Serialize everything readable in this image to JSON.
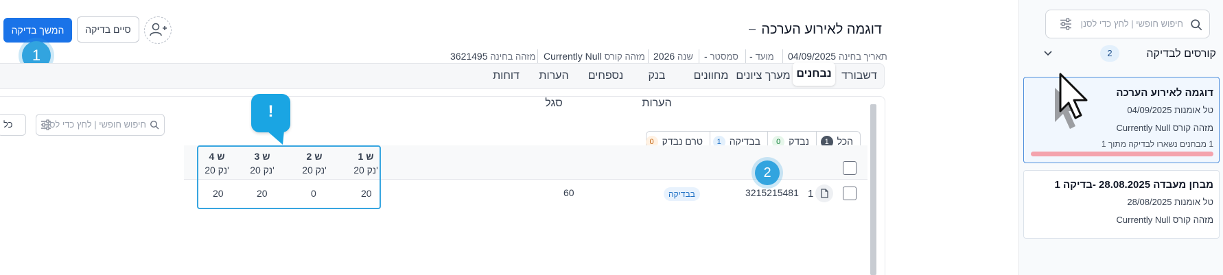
{
  "header": {
    "title": "דוגמה לאירוע הערכה",
    "collapse_symbol": "–",
    "continue_button": "המשך בדיקה",
    "finish_button": "סיים בדיקה",
    "meta": [
      {
        "label": "תאריך בחינה",
        "value": "04/09/2025"
      },
      {
        "label": "מועד",
        "value": "-"
      },
      {
        "label": "סמסטר",
        "value": "-"
      },
      {
        "label": "שנה",
        "value": "2026"
      },
      {
        "label": "מזהה קורס",
        "value": "Currently Null"
      },
      {
        "label": "מזהה בחינה",
        "value": "3621495"
      }
    ]
  },
  "tabs": [
    "דשבורד",
    "נבחנים",
    "מערך ציונים",
    "מחוונים",
    "בנק הערות",
    "נספחים",
    "הערות סגל",
    "דוחות"
  ],
  "active_tab": "נבחנים",
  "filters": [
    {
      "label": "הכל",
      "count": "1"
    },
    {
      "label": "נבדק",
      "count": "0"
    },
    {
      "label": "בבדיקה",
      "count": "1"
    },
    {
      "label": "טרם נבדק",
      "count": "0"
    }
  ],
  "search": {
    "placeholder": "חיפוש חופשי | לחץ כדי לסנן"
  },
  "left_button": "כל",
  "columns": [
    {
      "title": "ש 1",
      "sub": "20 נק'"
    },
    {
      "title": "ש 2",
      "sub": "20 נק'"
    },
    {
      "title": "ש 3",
      "sub": "20 נק'"
    },
    {
      "title": "ש 4",
      "sub": "20 נק'"
    }
  ],
  "row": {
    "index": "1",
    "student_id": "3215215481",
    "status": "בבדיקה",
    "total": "60",
    "scores": [
      "20",
      "0",
      "20",
      "20"
    ]
  },
  "callouts": {
    "one": "1",
    "two": "2",
    "alert": "!"
  },
  "sidebar": {
    "search_placeholder": "חיפוש חופשי | לחץ כדי לסנן",
    "section_title": "קורסים לבדיקה",
    "section_count": "2",
    "cards": [
      {
        "title": "דוגמה לאירוע הערכה",
        "line1": "טל אומנות 04/09/2025",
        "line2": "מזהה קורס Currently Null",
        "line3": "1 מבחנים נשארו לבדיקה מתוך 1",
        "progress": 1.0
      },
      {
        "title": "מבחן מעבדה 28.08.2025 -בדיקה 1",
        "line1": "טל אומנות 28/08/2025",
        "line2": "מזהה קורס Currently Null"
      }
    ]
  },
  "colors": {
    "primary": "#1a73e8",
    "callout": "#32a4df",
    "progress": "#f4a3ad",
    "highlight_border": "#37a5e0"
  }
}
